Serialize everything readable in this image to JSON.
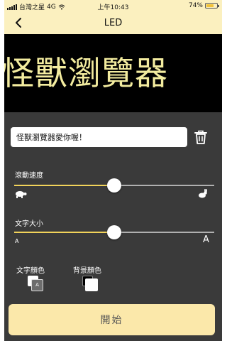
{
  "status_bar": {
    "carrier": "台灣之星",
    "network": "4G",
    "time": "上午10:43",
    "battery_percent": "74%",
    "battery_level": 0.74
  },
  "nav": {
    "title": "LED"
  },
  "banner": {
    "text": "怪獸瀏覽器"
  },
  "message": {
    "value": "怪獸瀏覽器愛你喔！"
  },
  "scroll_speed": {
    "label": "滾動速度",
    "value": 0.5
  },
  "font_size": {
    "label": "文字大小",
    "value": 0.5,
    "min_glyph": "A",
    "max_glyph": "A"
  },
  "text_color": {
    "label": "文字顏色",
    "swatch_glyph": "A"
  },
  "background_color": {
    "label": "背景顏色"
  },
  "start_button": {
    "label": "開始"
  },
  "colors": {
    "accent": "#f2d35a",
    "header_bg": "#fbf0bf",
    "banner_text": "#f3ec9f",
    "panel_bg": "#3a3a3a",
    "button_bg": "#fbe8aa"
  }
}
